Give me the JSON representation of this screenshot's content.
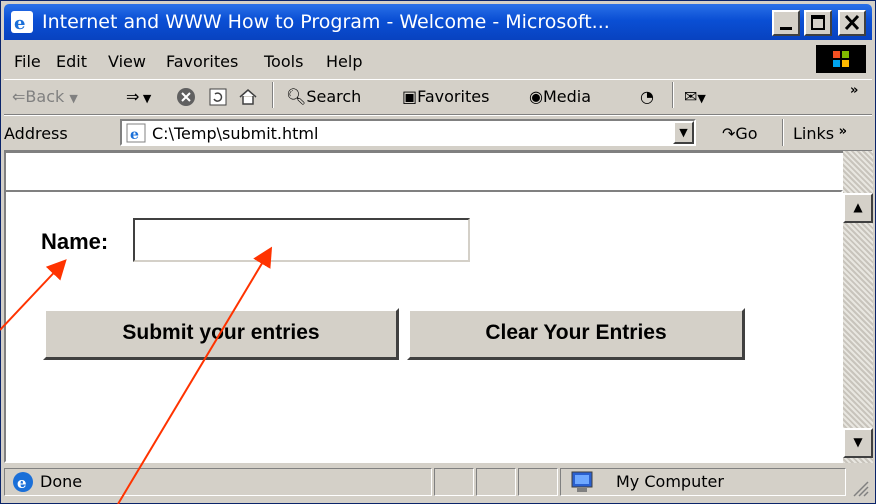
{
  "window": {
    "title": "Internet and WWW How to Program - Welcome - Microsoft..."
  },
  "menu": {
    "items": [
      {
        "label": "File"
      },
      {
        "label": "Edit"
      },
      {
        "label": "View"
      },
      {
        "label": "Favorites"
      },
      {
        "label": "Tools"
      },
      {
        "label": "Help"
      }
    ]
  },
  "toolbar": {
    "back_label": "Back",
    "search_label": "Search",
    "favorites_label": "Favorites",
    "media_label": "Media"
  },
  "address": {
    "label": "Address",
    "value": "C:\\Temp\\submit.html",
    "go_label": "Go",
    "links_label": "Links"
  },
  "form": {
    "name_label": "Name:",
    "name_value": "",
    "submit_label": "Submit your entries",
    "clear_label": "Clear Your Entries"
  },
  "status": {
    "text": "Done",
    "zone": "My Computer"
  },
  "colors": {
    "titlebar": "#0a4fd4",
    "arrow": "#ff3300"
  }
}
